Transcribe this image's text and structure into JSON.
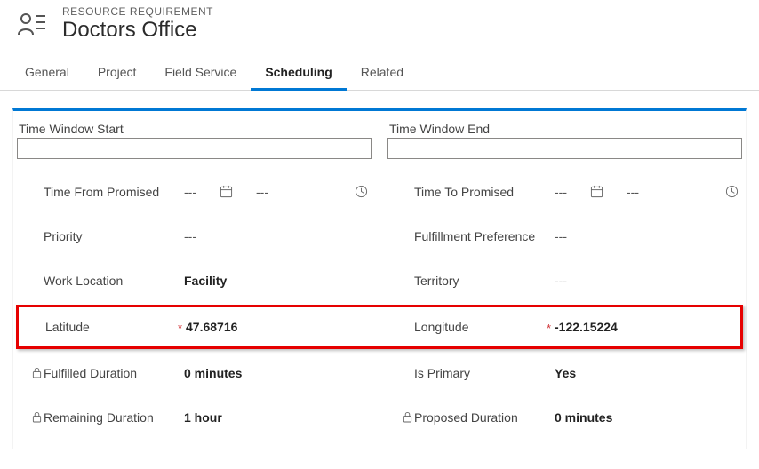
{
  "header": {
    "label": "RESOURCE REQUIREMENT",
    "title": "Doctors Office"
  },
  "tabs": [
    {
      "label": "General",
      "active": false
    },
    {
      "label": "Project",
      "active": false
    },
    {
      "label": "Field Service",
      "active": false
    },
    {
      "label": "Scheduling",
      "active": true
    },
    {
      "label": "Related",
      "active": false
    }
  ],
  "sections": {
    "left_title": "Time Window Start",
    "right_title": "Time Window End",
    "left_input_value": "",
    "right_input_value": ""
  },
  "dash": "---",
  "fields_left": {
    "time_from_promised": {
      "label": "Time From Promised",
      "date": "---",
      "time": "---"
    },
    "priority": {
      "label": "Priority",
      "value": "---"
    },
    "work_location": {
      "label": "Work Location",
      "value": "Facility"
    },
    "latitude": {
      "label": "Latitude",
      "value": "47.68716",
      "required": true
    },
    "fulfilled_duration": {
      "label": "Fulfilled Duration",
      "value": "0 minutes",
      "locked": true
    },
    "remaining_duration": {
      "label": "Remaining Duration",
      "value": "1 hour",
      "locked": true
    }
  },
  "fields_right": {
    "time_to_promised": {
      "label": "Time To Promised",
      "date": "---",
      "time": "---"
    },
    "fulfillment_preference": {
      "label": "Fulfillment Preference",
      "value": "---"
    },
    "territory": {
      "label": "Territory",
      "value": "---"
    },
    "longitude": {
      "label": "Longitude",
      "value": "-122.15224",
      "required": true
    },
    "is_primary": {
      "label": "Is Primary",
      "value": "Yes"
    },
    "proposed_duration": {
      "label": "Proposed Duration",
      "value": "0 minutes",
      "locked": true
    }
  }
}
